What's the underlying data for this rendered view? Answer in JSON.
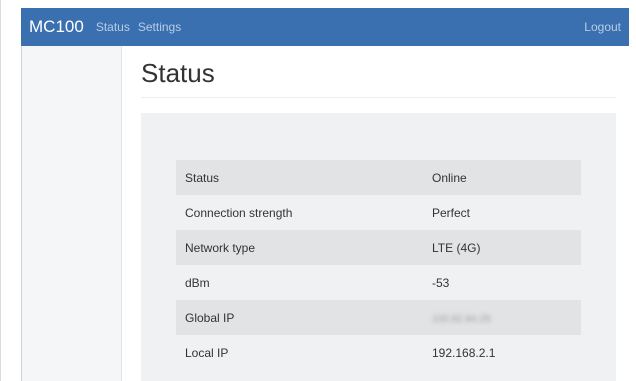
{
  "navbar": {
    "brand": "MC100",
    "links": [
      "Status",
      "Settings"
    ],
    "logout": "Logout"
  },
  "page": {
    "title": "Status"
  },
  "status_table": [
    {
      "label": "Status",
      "value": "Online"
    },
    {
      "label": "Connection strength",
      "value": "Perfect"
    },
    {
      "label": "Network type",
      "value": "LTE (4G)"
    },
    {
      "label": "dBm",
      "value": "-53"
    },
    {
      "label": "Global IP",
      "value": "100.82.84.29"
    },
    {
      "label": "Local IP",
      "value": "192.168.2.1"
    }
  ],
  "colors": {
    "navbar": "#3a6fb0",
    "panel": "#f0f1f2",
    "row_shade": "#e2e3e4"
  }
}
